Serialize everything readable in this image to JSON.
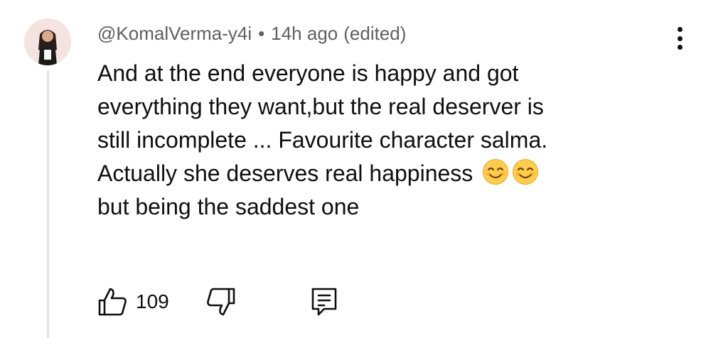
{
  "comment": {
    "author": "@KomalVerma-y4i",
    "separator": "•",
    "timestamp": "14h ago",
    "edited_label": "(edited)",
    "text_lines": [
      "And at the end everyone is happy and got",
      "everything they want,but the real deserver is",
      "still incomplete ... Favourite character salma.",
      "Actually she deserves real happiness",
      "but being the saddest one"
    ],
    "emojis": [
      "smiling-face-emoji",
      "smiling-face-emoji"
    ],
    "like_count": "109"
  },
  "icons": {
    "avatar": "avatar-image",
    "menu": "more-vertical-icon",
    "like": "thumbs-up-icon",
    "dislike": "thumbs-down-icon",
    "reply": "comment-reply-icon"
  },
  "colors": {
    "text": "#0f0f0f",
    "meta_text": "#606060",
    "emoji_face": "#ffcc4d",
    "thread_line": "#e3e3e3"
  }
}
